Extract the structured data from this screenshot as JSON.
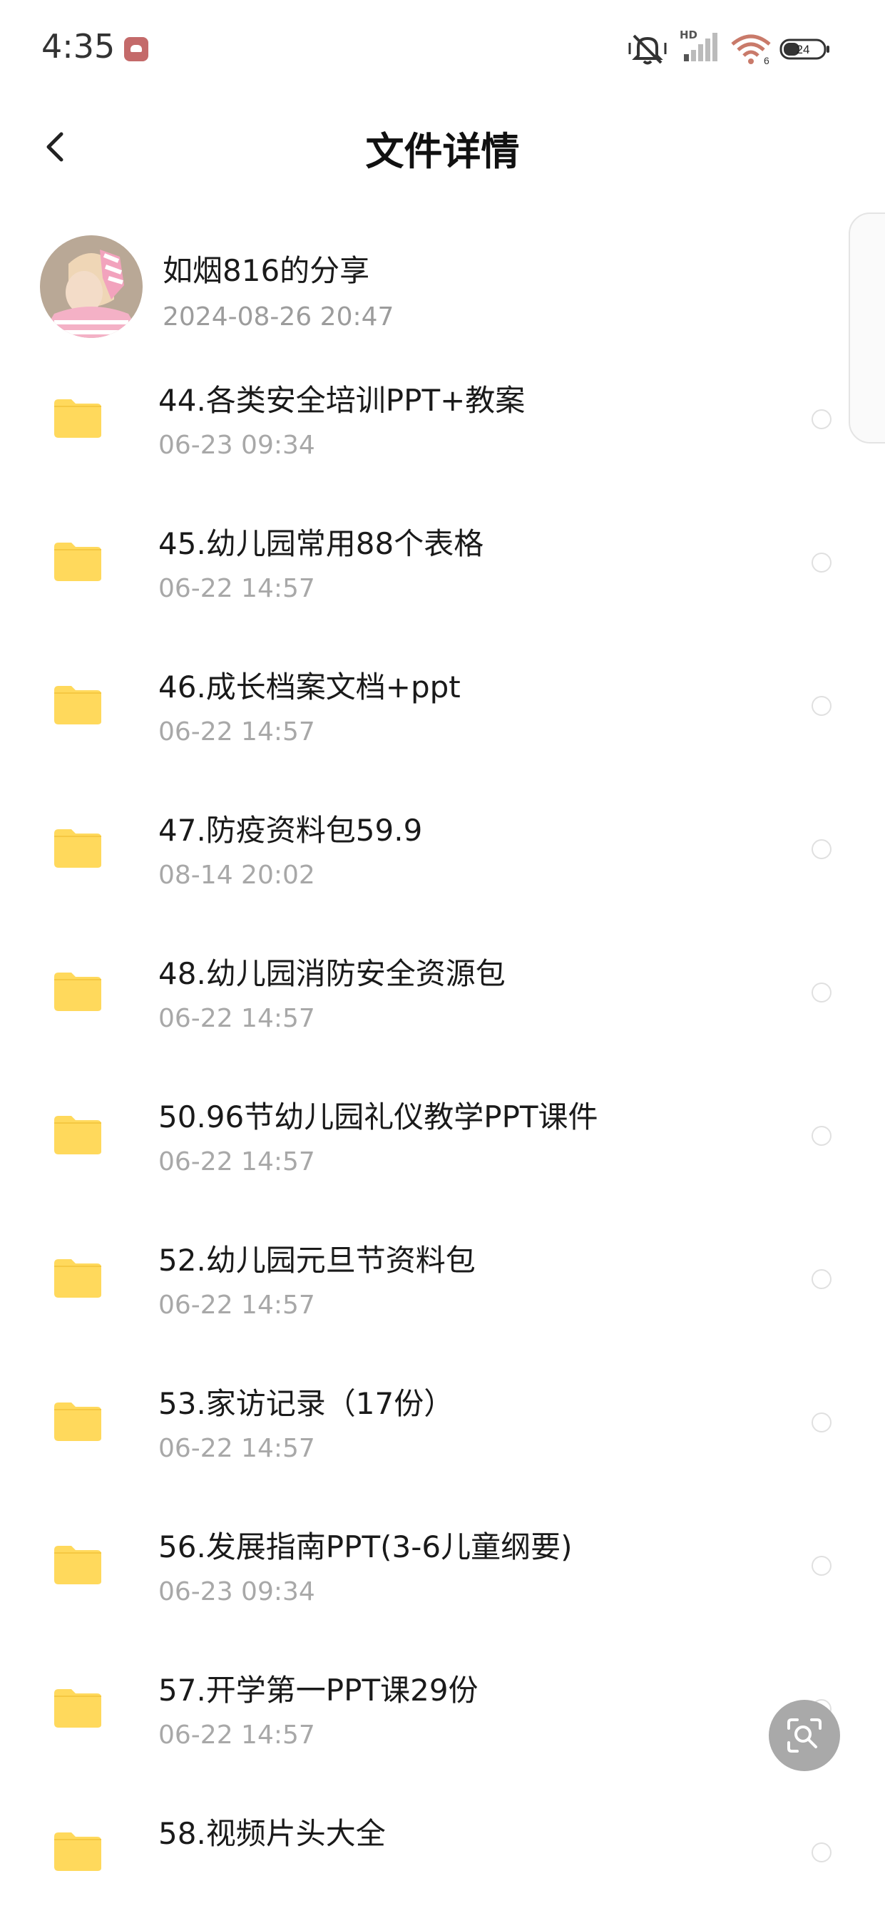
{
  "status_bar": {
    "time": "4:35",
    "network": "HD",
    "wifi_badge": "6",
    "battery": "24"
  },
  "header": {
    "title": "文件详情"
  },
  "share": {
    "owner": "如烟816的分享",
    "date": "2024-08-26  20:47"
  },
  "files": [
    {
      "name": "44.各类安全培训PPT+教案",
      "date": "06-23  09:34"
    },
    {
      "name": "45.幼儿园常用88个表格",
      "date": "06-22  14:57"
    },
    {
      "name": "46.成长档案文档+ppt",
      "date": "06-22  14:57"
    },
    {
      "name": "47.防疫资料包59.9",
      "date": "08-14  20:02"
    },
    {
      "name": "48.幼儿园消防安全资源包",
      "date": "06-22  14:57"
    },
    {
      "name": "50.96节幼儿园礼仪教学PPT课件",
      "date": "06-22  14:57"
    },
    {
      "name": "52.幼儿园元旦节资料包",
      "date": "06-22  14:57"
    },
    {
      "name": "53.家访记录（17份）",
      "date": "06-22  14:57"
    },
    {
      "name": "56.发展指南PPT(3-6儿童纲要)",
      "date": "06-23  09:34"
    },
    {
      "name": "57.开学第一PPT课29份",
      "date": "06-22  14:57"
    },
    {
      "name": "58.视频片头大全",
      "date": ""
    }
  ],
  "colors": {
    "folder": "#FFD95C",
    "folder_tab": "#F5C842",
    "secondary_text": "#A8A8A8",
    "float_button": "#A9A9A9"
  }
}
